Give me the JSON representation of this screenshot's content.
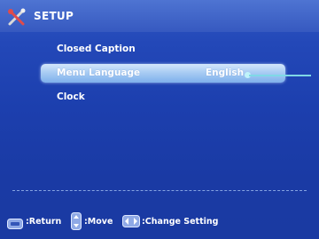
{
  "header": {
    "title": "SETUP",
    "icon": "tools-icon"
  },
  "menu": {
    "items": [
      {
        "label": "Closed Caption",
        "value": ""
      },
      {
        "label": "Menu Language",
        "value": "English"
      },
      {
        "label": "Clock",
        "value": ""
      }
    ],
    "selected_index": 1
  },
  "footer": {
    "hints": [
      {
        "icon": "menu-key-icon",
        "text": ":Return"
      },
      {
        "icon": "up-down-key-icon",
        "text": ":Move"
      },
      {
        "icon": "left-right-key-icon",
        "text": ":Change Setting"
      }
    ]
  },
  "colors": {
    "background": "#1f3ea8",
    "highlight": "#a9ccf3",
    "pointer": "#7fd8e6"
  }
}
